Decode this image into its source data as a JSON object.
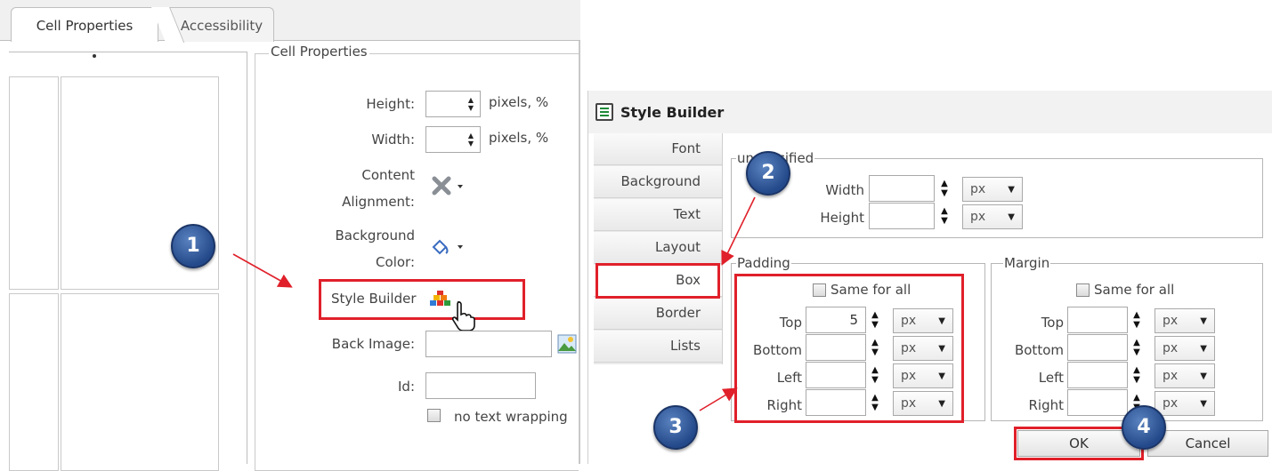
{
  "left_dialog": {
    "tabs": [
      {
        "label": "Cell Properties",
        "active": true
      },
      {
        "label": "Accessibility",
        "active": false
      }
    ],
    "section_title": "Cell Properties",
    "height_label": "Height:",
    "height_unit": "pixels, %",
    "width_label": "Width:",
    "width_unit": "pixels, %",
    "content_alignment_label_1": "Content",
    "content_alignment_label_2": "Alignment:",
    "background_color_label_1": "Background",
    "background_color_label_2": "Color:",
    "style_builder_label": "Style Builder",
    "back_image_label": "Back Image:",
    "id_label": "Id:",
    "no_wrap_label": "no text wrapping"
  },
  "style_builder": {
    "title": "Style Builder",
    "tabs": [
      {
        "label": "Font"
      },
      {
        "label": "Background"
      },
      {
        "label": "Text"
      },
      {
        "label": "Layout"
      },
      {
        "label": "Box",
        "active": true
      },
      {
        "label": "Border"
      },
      {
        "label": "Lists"
      }
    ],
    "unspecified_legend": "unspecified",
    "width_label": "Width",
    "height_label": "Height",
    "unit": "px",
    "padding": {
      "legend": "Padding",
      "same_for_all": "Same for all",
      "top_label": "Top",
      "top_value": "5",
      "bottom_label": "Bottom",
      "left_label": "Left",
      "right_label": "Right"
    },
    "margin": {
      "legend": "Margin",
      "same_for_all": "Same for all",
      "top_label": "Top",
      "bottom_label": "Bottom",
      "left_label": "Left",
      "right_label": "Right"
    },
    "ok_label": "OK",
    "cancel_label": "Cancel"
  },
  "callouts": [
    "1",
    "2",
    "3",
    "4"
  ],
  "colors": {
    "highlight": "#e0202a",
    "badge": "#2a4f8f"
  }
}
